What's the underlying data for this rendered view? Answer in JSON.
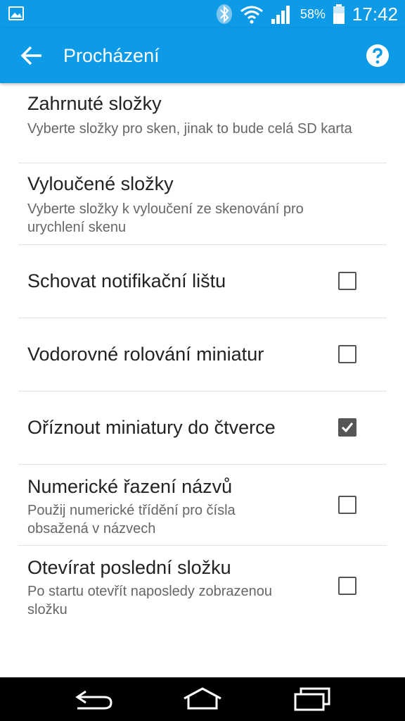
{
  "status_bar": {
    "battery_percent": "58%",
    "time": "17:42",
    "icons": [
      "image-icon",
      "bluetooth-icon",
      "wifi-icon",
      "signal-icon",
      "battery-icon"
    ]
  },
  "app_bar": {
    "title": "Procházení",
    "icons": [
      "back-arrow-icon",
      "help-icon"
    ]
  },
  "settings": [
    {
      "title": "Zahrnuté složky",
      "summary": "Vyberte složky pro sken, jinak to bude celá SD karta"
    },
    {
      "title": "Vyloučené složky",
      "summary": "Vyberte složky k vyloučení ze skenování pro urychlení skenu"
    },
    {
      "title": "Schovat notifikační lištu",
      "checked": false
    },
    {
      "title": "Vodorovné rolování miniatur",
      "checked": false
    },
    {
      "title": "Oříznout miniatury do čtverce",
      "checked": true
    },
    {
      "title": "Numerické řazení názvů",
      "summary": "Použij numerické třídění pro čísla obsažená v názvech",
      "checked": false
    },
    {
      "title": "Otevírat poslední složku",
      "summary": "Po startu otevřít naposledy zobrazenou složku",
      "checked": false
    }
  ],
  "nav_bar": {
    "icons": [
      "nav-back-icon",
      "nav-home-icon",
      "nav-recents-icon"
    ]
  }
}
